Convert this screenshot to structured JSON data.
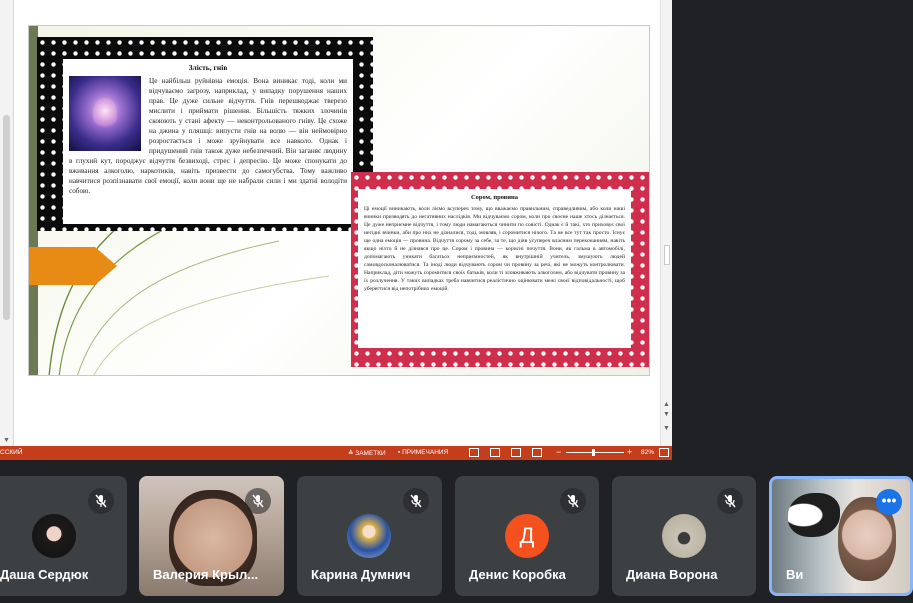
{
  "slide": {
    "card1": {
      "title": "Злість, гнів",
      "body": "Це найбільш руйнівна емоція. Вона виникає тоді, коли ми відчуваємо загрозу, наприклад, у випадку порушення наших прав. Це дуже сильне відчуття. Гнів перешкоджає тверезо мислити і приймати рішення. Більшість тяжких злочинів скоюють у стані афекту — неконтрольованого гніву. Це схоже на джина у пляшці: випусти гнів на волю — він неймовірно розростається і може зруйнувати все навколо. Однак і придушений гнів також дуже небезпечний. Він заганяє людину в глухий кут, породжує відчуття безвиході, стрес і депресію. Це може спонукати до вживання алкоголю, наркотиків, навіть призвести до самогубства. Тому важливо навчитися розпізнавати свої емоції, коли вони ще не набрали сили і ми здатні володіти собою."
    },
    "card2": {
      "title": "Сором, провина",
      "body": "Ці емоції виникають, коли ліємо всупереч тому, що вважаємо правильним, справедливим, або коли наші вчинки призводять до негативних наслідків. Ми відчуваємо сором, коли про своєне наше хтось дізнається. Це дуже неприємне відчуття, і тому люди намагаються чинити по совісті. Однак є й такі, хто приховує свої негідні вчинки, аби про них не дізналися, тоді, мовляв, і соромитися нічого. Та не все тут так просто. Існує ще одна емоція — провина. Відчуття сорому за себе, за те, що діяв усупереч власним переконанням, навіть якщо ніхто й не дізнався про це. Сором і провина — корисні почуття. Вони, як гальма в автомобілі, допомагають уникати багатьох неприємностей, як внутрішній учитель, змушують людей самовдосконалюватися. Та іноді люди відчувають сором чи провину за речі, які не можуть контролювати. Наприклад, діти можуть соромитися своїх батьків, коли ті зловживають алкоголем, або відчувати провину за їх розлучення. У таких випадках треба навчитися реалістично оцінювати межі своєї відповідальності, щоб уберегтися від непотрібних емоцій."
    }
  },
  "statusbar": {
    "language": "ССКИЙ",
    "notes": "ЗАМЕТКИ",
    "comments": "ПРИМЕЧАНИЯ",
    "zoom_minus": "−",
    "zoom_plus": "+",
    "zoom": "82%",
    "zoom_fraction": 0.45,
    "accent_color": "#c43e1c"
  },
  "participants": [
    {
      "name": "Даша Сердюк",
      "muted": true,
      "avatar": "photo-dark"
    },
    {
      "name": "Валерия Крыл...",
      "muted": true,
      "avatar": "video"
    },
    {
      "name": "Карина Думнич",
      "muted": true,
      "avatar": "photo-blue"
    },
    {
      "name": "Денис Коробка",
      "muted": true,
      "avatar": "letter",
      "letter": "Д",
      "color": "#f4511e"
    },
    {
      "name": "Диана Ворона",
      "muted": true,
      "avatar": "photo"
    },
    {
      "name": "Ви",
      "muted": false,
      "avatar": "video",
      "more_icon": "more-dots-icon",
      "highlight": "#8ab4f8"
    }
  ]
}
